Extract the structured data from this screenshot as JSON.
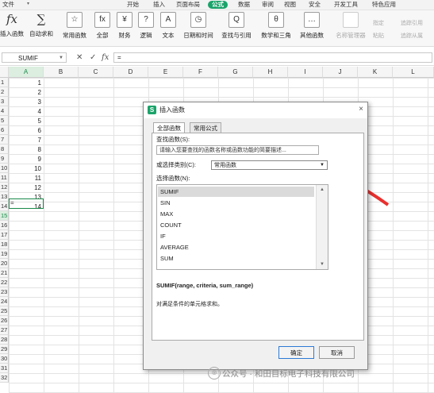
{
  "menu": {
    "file": "文件",
    "items": [
      "开始",
      "插入",
      "页面布局",
      "公式",
      "数据",
      "审阅",
      "视图",
      "安全",
      "开发工具",
      "特色应用"
    ],
    "active": "公式"
  },
  "ribbon": {
    "insert_function": "插入函数",
    "autosum": "自动求和",
    "common": "常用函数",
    "all": "全部",
    "finance": "财务",
    "logic": "逻辑",
    "text": "文本",
    "datetime": "日期和时间",
    "lookup": "查找与引用",
    "math": "数学和三角",
    "other": "其他函数",
    "name_manager": "名称管理器",
    "paste": "粘贴",
    "specify": "指定",
    "trace_precedents": "追踪引用",
    "trace_dependents": "追踪从属",
    "icons": {
      "fx": "fx",
      "sum": "∑",
      "star": "☆",
      "fx2": "fx",
      "currency": "¥",
      "question": "?",
      "text_a": "A",
      "clock": "◷",
      "search": "Q",
      "theta": "θ",
      "dots": "…"
    }
  },
  "formula_bar": {
    "name_box": "SUMIF",
    "cancel": "✕",
    "confirm": "✓",
    "fx": "fx",
    "value": "="
  },
  "grid": {
    "columns": [
      "A",
      "B",
      "C",
      "D",
      "E",
      "F",
      "G",
      "H",
      "I",
      "J",
      "K",
      "L"
    ],
    "rows": [
      "1",
      "2",
      "3",
      "4",
      "5",
      "6",
      "7",
      "8",
      "9",
      "10",
      "11",
      "12",
      "13",
      "14",
      "15",
      "16",
      "17",
      "18",
      "19",
      "20",
      "21",
      "22",
      "23",
      "24",
      "25",
      "26",
      "27",
      "28",
      "29",
      "30",
      "31",
      "32"
    ],
    "values": [
      "1",
      "2",
      "3",
      "4",
      "5",
      "6",
      "7",
      "8",
      "9",
      "10",
      "11",
      "12",
      "13",
      "14"
    ],
    "active_cell_text": "="
  },
  "dialog": {
    "title": "插入函数",
    "close": "×",
    "tabs": [
      "全部函数",
      "常用公式"
    ],
    "search_label": "查找函数(S):",
    "search_placeholder": "请输入您要查找的函数名称或函数功能的简要描述...",
    "category_label": "或选择类别(C):",
    "category_value": "常用函数",
    "list_label": "选择函数(N):",
    "functions": [
      "SUMIF",
      "SIN",
      "MAX",
      "COUNT",
      "IF",
      "AVERAGE",
      "SUM"
    ],
    "selected_function": "SUMIF",
    "signature": "SUMIF(range, criteria, sum_range)",
    "description": "对满足条件的单元格求和。",
    "ok": "确定",
    "cancel": "取消"
  },
  "watermark": {
    "text": "公众号 · 和田目标电子科技有限公司"
  },
  "colors": {
    "accent_green": "#1ba36a",
    "arrow_red": "#e8312f",
    "ok_border": "#2c7bd6"
  }
}
